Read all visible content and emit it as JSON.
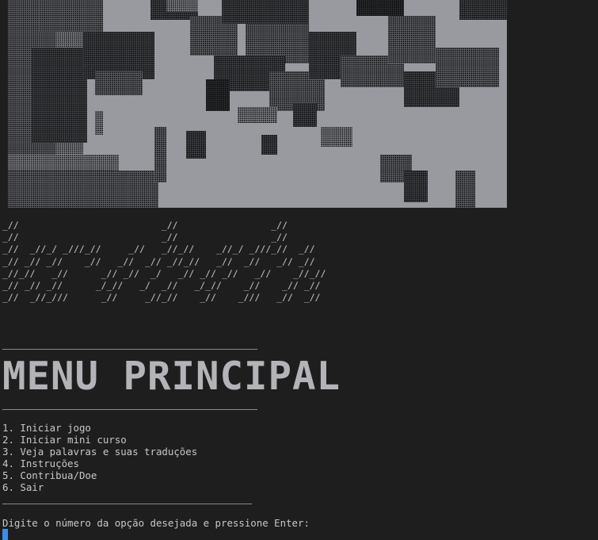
{
  "banner": {
    "lines": [
      "_//                          _//                 _//",
      "_//                          _//                 _//",
      "_//  _//_/ _///_//     _//   _//_//    _//_/ _///_//  _//",
      "_// _// _//    _//   _//  _// _//_//   _//  _//   _// _//",
      "_//_//   _//      _// _//  _/   _// _// _//   _//    _//_//",
      "_// _// _//      _/_//   _/  _//   _/_//    _//    _// _//",
      "_//  _//_///      _//     _//_//    _//    _///   _//  _//"
    ]
  },
  "menu": {
    "title": "MENU PRINCIPAL",
    "options": [
      "1. Iniciar jogo",
      "2. Iniciar mini curso",
      "3. Veja palavras e suas traduções",
      "4. Instruções",
      "5. Contribua/Doe",
      "6. Sair"
    ],
    "prompt": "Digite o número da opção desejada e pressione Enter:"
  },
  "colors": {
    "background": "#1e1e1e",
    "text": "#c8c8c8",
    "cursor": "#3b8eea",
    "image_light": "#999aa0"
  }
}
